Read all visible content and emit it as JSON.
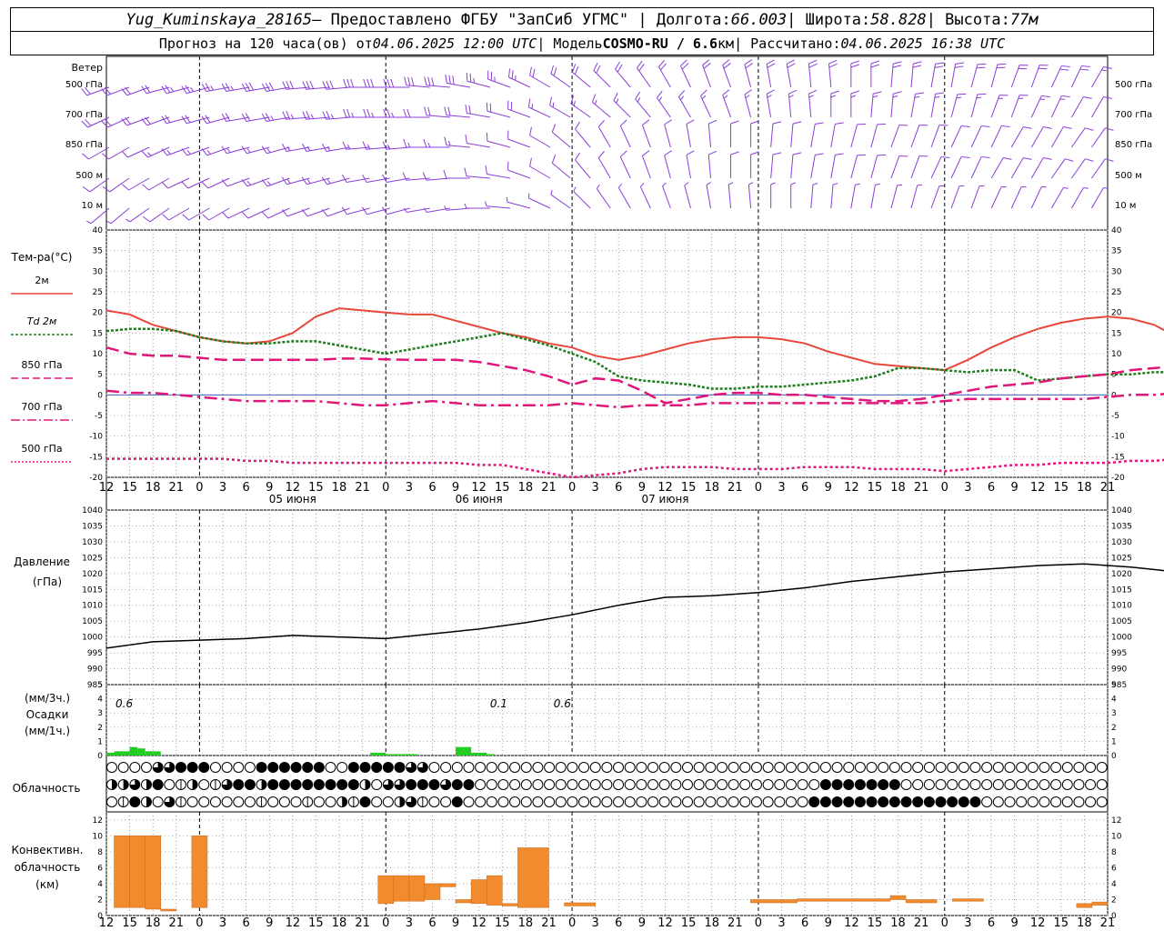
{
  "header": {
    "station": "Yug_Kuminskaya_28165",
    "provider": " — Предоставлено ФГБУ \"ЗапСиб УГМС\" | Долгота: ",
    "lon": "66.003",
    "lat_label": " | Широта: ",
    "lat": "58.828",
    "alt_label": " | Высота: ",
    "alt": "77м",
    "forecast_prefix": "Прогноз на 120 часа(ов) от ",
    "forecast_from": "04.06.2025 12:00 UTC",
    "model_label": " | Модель ",
    "model": "COSMO-RU / 6.6",
    "model_unit": "км",
    "calc_label": " | Рассчитано: ",
    "calc_time": "04.06.2025 16:38 UTC"
  },
  "labels": {
    "wind": "Ветер",
    "wind_levels": [
      "500 гПа",
      "700 гПа",
      "850 гПа",
      "500 м",
      "10   м"
    ],
    "temp": "Тем-ра(°C)",
    "legend": [
      "2м",
      "Td  2м",
      "850 гПа",
      "700 гПа",
      "500 гПа"
    ],
    "pressure": [
      "Давление",
      "(гПа)"
    ],
    "precip": [
      "(мм/3ч.)",
      "Осадки",
      "(мм/1ч.)"
    ],
    "precip_totals": [
      "0.6",
      "0.1",
      "0.6"
    ],
    "cloud": "Облачность",
    "conv": [
      "Конвективн.",
      "облачность",
      "(км)"
    ],
    "days": [
      "05 июня",
      "06 июня",
      "07 июня"
    ],
    "hours": [
      "12",
      "15",
      "18",
      "21",
      "0",
      "3",
      "6",
      "9",
      "12",
      "15",
      "18",
      "21",
      "0",
      "3",
      "6",
      "9",
      "12",
      "15",
      "18",
      "21",
      "0",
      "3",
      "6",
      "9",
      "12",
      "15",
      "18"
    ]
  },
  "colors": {
    "t2m": "#e8483c",
    "td2m": "#1e7d1e",
    "t850": "#e0177a",
    "t700": "#e0177a",
    "t500": "#e0177a",
    "wind": "#8a3fd6",
    "precip": "#22cc22",
    "conv": "#f28a2e"
  },
  "chart_data": [
    {
      "type": "line",
      "title": "Тем-ра(°C)",
      "ylim": [
        -20,
        40
      ],
      "x_hours_from_start": [
        0,
        3,
        6,
        9,
        12,
        15,
        18,
        21,
        24,
        27,
        30,
        33,
        36,
        39,
        42,
        45,
        48,
        51,
        54,
        57,
        60,
        63,
        66,
        69,
        72,
        75,
        78,
        81,
        84,
        87,
        90,
        93,
        96,
        99,
        102,
        105,
        108,
        111,
        114,
        117,
        120,
        123,
        126,
        129,
        132,
        135,
        138,
        141,
        144,
        147,
        150
      ],
      "series": [
        {
          "name": "2м",
          "values": [
            20.5,
            19.5,
            17,
            15.5,
            14,
            13,
            12.5,
            13,
            15,
            19,
            21,
            20.5,
            20,
            19.5,
            19.5,
            18,
            16.5,
            15,
            14,
            12.5,
            11.5,
            9.5,
            8.5,
            9.5,
            11,
            12.5,
            13.5,
            14,
            14,
            13.5,
            12.5,
            10.5,
            9,
            7.5,
            7,
            6.5,
            6,
            8.5,
            11.5,
            14,
            16,
            17.5,
            18.5,
            19,
            18.5,
            17,
            14,
            10.5,
            9,
            8.5,
            8
          ]
        },
        {
          "name": "Td 2м",
          "values": [
            15.5,
            16,
            16,
            15.5,
            14,
            13,
            12.5,
            12.5,
            13,
            13,
            12,
            11,
            10,
            11,
            12,
            13,
            14,
            15,
            13.5,
            12,
            10,
            8,
            4.5,
            3.5,
            3,
            2.5,
            1.5,
            1.5,
            2,
            2,
            2.5,
            3,
            3.5,
            4.5,
            6.5,
            6.5,
            6,
            5.5,
            6,
            6,
            3.5,
            4,
            4.5,
            5,
            5,
            5.5,
            5.5,
            8,
            7.5,
            7,
            7
          ]
        },
        {
          "name": "850 гПа",
          "values": [
            11.5,
            10,
            9.5,
            9.5,
            9,
            8.5,
            8.5,
            8.5,
            8.5,
            8.5,
            8.8,
            8.8,
            8.6,
            8.5,
            8.5,
            8.5,
            8,
            7,
            6,
            4.5,
            2.5,
            4,
            3.5,
            1,
            -2,
            -1,
            0,
            0.5,
            0.5,
            0,
            0,
            -0.5,
            -1,
            -1.5,
            -1.5,
            -1,
            0,
            1,
            2,
            2.5,
            3,
            4,
            4.5,
            5,
            6,
            6.5,
            7,
            7.5,
            8,
            8,
            8
          ]
        },
        {
          "name": "700 гПа",
          "values": [
            1,
            0.5,
            0.5,
            0,
            -0.5,
            -1,
            -1.5,
            -1.5,
            -1.5,
            -1.5,
            -2,
            -2.5,
            -2.5,
            -2,
            -1.5,
            -2,
            -2.5,
            -2.5,
            -2.5,
            -2.5,
            -2,
            -2.5,
            -3,
            -2.5,
            -2.5,
            -2.5,
            -2,
            -2,
            -2,
            -2,
            -2,
            -2,
            -2,
            -2,
            -2,
            -2,
            -1.5,
            -1,
            -1,
            -1,
            -1,
            -1,
            -1,
            -0.5,
            0,
            0,
            0.5,
            0.5,
            1,
            1.5,
            1.5
          ]
        },
        {
          "name": "500 гПа",
          "values": [
            -15.5,
            -15.5,
            -15.5,
            -15.5,
            -15.5,
            -15.5,
            -16,
            -16,
            -16.5,
            -16.5,
            -16.5,
            -16.5,
            -16.5,
            -16.5,
            -16.5,
            -16.5,
            -17,
            -17,
            -18,
            -19,
            -20,
            -19.5,
            -19,
            -18,
            -17.5,
            -17.5,
            -17.5,
            -18,
            -18,
            -18,
            -17.5,
            -17.5,
            -17.5,
            -18,
            -18,
            -18,
            -18.5,
            -18,
            -17.5,
            -17,
            -17,
            -16.5,
            -16.5,
            -16.5,
            -16,
            -16,
            -15.5,
            -15.5,
            -15,
            -15,
            -15
          ]
        }
      ]
    },
    {
      "type": "line",
      "title": "Давление (гПа)",
      "ylim": [
        985,
        1040
      ],
      "x_hours_from_start": [
        0,
        6,
        12,
        18,
        24,
        30,
        36,
        42,
        48,
        54,
        60,
        66,
        72,
        78,
        84,
        90,
        96,
        102,
        108,
        114,
        120,
        126,
        132,
        138,
        144,
        150
      ],
      "series": [
        {
          "name": "Давление",
          "values": [
            996.5,
            998.5,
            999,
            999.5,
            1000.5,
            1000,
            999.5,
            1001,
            1002.5,
            1004.5,
            1007,
            1010,
            1012.5,
            1013,
            1014,
            1015.5,
            1017.5,
            1019,
            1020.5,
            1021.5,
            1022.5,
            1023,
            1022,
            1020.5,
            1020.5,
            1021.5
          ]
        }
      ]
    },
    {
      "type": "bar",
      "title": "Осадки (мм/1ч.)",
      "ylim": [
        0,
        5
      ],
      "x_hours_from_start": [
        0,
        1,
        2,
        3,
        4,
        5,
        6,
        34,
        35,
        36,
        37,
        38,
        39,
        45,
        46,
        47,
        48,
        49
      ],
      "values": [
        0.2,
        0.3,
        0.3,
        0.6,
        0.5,
        0.3,
        0.3,
        0.2,
        0.2,
        0.1,
        0.1,
        0.1,
        0.1,
        0.6,
        0.6,
        0.2,
        0.2,
        0.1
      ]
    },
    {
      "type": "bar",
      "title": "Конвективн. облачность (км)",
      "ylim": [
        0,
        12
      ],
      "bars": [
        {
          "start_h": 1,
          "end_h": 3,
          "base": 1,
          "top": 10
        },
        {
          "start_h": 3,
          "end_h": 5,
          "base": 1,
          "top": 10
        },
        {
          "start_h": 5,
          "end_h": 7,
          "base": 0.8,
          "top": 10
        },
        {
          "start_h": 7,
          "end_h": 9,
          "base": 0.7,
          "top": 0.8
        },
        {
          "start_h": 11,
          "end_h": 13,
          "base": 1,
          "top": 10
        },
        {
          "start_h": 35,
          "end_h": 37,
          "base": 1.5,
          "top": 5
        },
        {
          "start_h": 37,
          "end_h": 39,
          "base": 1.8,
          "top": 5
        },
        {
          "start_h": 39,
          "end_h": 41,
          "base": 1.8,
          "top": 5
        },
        {
          "start_h": 41,
          "end_h": 43,
          "base": 2,
          "top": 4
        },
        {
          "start_h": 43,
          "end_h": 45,
          "base": 3.6,
          "top": 4
        },
        {
          "start_h": 45,
          "end_h": 47,
          "base": 1.6,
          "top": 2
        },
        {
          "start_h": 47,
          "end_h": 49,
          "base": 1.5,
          "top": 4.5
        },
        {
          "start_h": 49,
          "end_h": 51,
          "base": 1.3,
          "top": 5
        },
        {
          "start_h": 51,
          "end_h": 53,
          "base": 1.2,
          "top": 1.5
        },
        {
          "start_h": 53,
          "end_h": 57,
          "base": 1,
          "top": 8.5
        },
        {
          "start_h": 59,
          "end_h": 63,
          "base": 1.2,
          "top": 1.6
        },
        {
          "start_h": 83,
          "end_h": 89,
          "base": 1.6,
          "top": 2
        },
        {
          "start_h": 89,
          "end_h": 101,
          "base": 1.8,
          "top": 2.1
        },
        {
          "start_h": 101,
          "end_h": 103,
          "base": 2,
          "top": 2.5
        },
        {
          "start_h": 103,
          "end_h": 107,
          "base": 1.6,
          "top": 2
        },
        {
          "start_h": 109,
          "end_h": 113,
          "base": 1.8,
          "top": 2.1
        },
        {
          "start_h": 125,
          "end_h": 127,
          "base": 1,
          "top": 1.5
        },
        {
          "start_h": 127,
          "end_h": 129,
          "base": 1.3,
          "top": 1.7
        }
      ]
    }
  ],
  "cloud_rows": [
    "00003344400004444440044444330000000000000000000000000000000000000000000000000000000000000004",
    "22324012013442444444442033444344000000000000000000000000000000444444400000000000000000000004",
    "01420310000001000100214002310040000000000000000000000000000004444444444444440000000000000000"
  ],
  "wind_rows": [
    {
      "level": "500 гПа",
      "dir_deg": [
        250,
        250,
        250,
        255,
        255,
        255,
        260,
        260,
        260,
        260,
        265,
        265,
        265,
        270,
        270,
        270,
        275,
        275,
        280,
        285,
        290,
        295,
        300,
        305,
        310,
        315,
        320,
        325,
        330,
        335,
        340,
        340,
        345,
        350,
        350,
        355,
        355,
        0,
        0,
        5,
        5,
        10,
        10,
        15,
        15,
        20,
        20,
        25,
        25,
        30
      ],
      "speed": [
        20,
        20,
        22,
        22,
        24,
        25,
        25,
        26,
        28,
        28,
        30,
        30,
        32,
        32,
        32,
        30,
        30,
        28,
        28,
        26,
        25,
        25,
        22,
        22,
        20,
        20,
        20,
        18,
        18,
        18,
        18,
        18,
        18,
        18,
        20,
        20,
        20,
        20,
        20,
        22,
        22,
        22,
        22,
        22,
        22,
        20,
        20,
        18,
        18,
        16
      ]
    },
    {
      "level": "700 гПа",
      "dir_deg": [
        245,
        245,
        250,
        250,
        255,
        255,
        255,
        260,
        260,
        260,
        265,
        265,
        265,
        270,
        270,
        270,
        270,
        275,
        275,
        280,
        285,
        290,
        295,
        300,
        305,
        310,
        315,
        320,
        325,
        330,
        335,
        340,
        345,
        350,
        355,
        355,
        0,
        0,
        5,
        5,
        10,
        10,
        15,
        15,
        20,
        20,
        25,
        25,
        30,
        30
      ],
      "speed": [
        18,
        18,
        18,
        20,
        20,
        20,
        22,
        22,
        22,
        24,
        24,
        24,
        25,
        25,
        24,
        24,
        22,
        22,
        20,
        20,
        18,
        18,
        16,
        16,
        15,
        15,
        15,
        14,
        14,
        14,
        14,
        14,
        14,
        15,
        15,
        15,
        15,
        15,
        16,
        16,
        16,
        16,
        15,
        15,
        15,
        14,
        14,
        13,
        12,
        12
      ]
    },
    {
      "level": "850 гПа",
      "dir_deg": [
        240,
        240,
        245,
        245,
        250,
        250,
        250,
        255,
        255,
        255,
        260,
        260,
        260,
        265,
        265,
        265,
        270,
        270,
        275,
        280,
        285,
        290,
        300,
        310,
        320,
        330,
        335,
        340,
        345,
        350,
        355,
        0,
        0,
        5,
        5,
        10,
        10,
        15,
        15,
        20,
        20,
        20,
        25,
        25,
        25,
        30,
        30,
        30,
        35,
        35
      ],
      "speed": [
        12,
        12,
        12,
        14,
        14,
        14,
        15,
        15,
        15,
        16,
        16,
        16,
        16,
        16,
        16,
        15,
        15,
        14,
        14,
        12,
        12,
        10,
        10,
        10,
        10,
        10,
        10,
        10,
        12,
        12,
        12,
        12,
        12,
        12,
        12,
        12,
        12,
        12,
        12,
        12,
        12,
        12,
        12,
        10,
        10,
        10,
        10,
        10,
        10,
        10
      ]
    },
    {
      "level": "500 м",
      "dir_deg": [
        235,
        235,
        240,
        240,
        245,
        245,
        245,
        250,
        250,
        250,
        255,
        255,
        255,
        260,
        260,
        260,
        265,
        265,
        270,
        275,
        280,
        290,
        300,
        310,
        320,
        330,
        335,
        340,
        345,
        350,
        355,
        0,
        0,
        5,
        5,
        10,
        10,
        15,
        15,
        20,
        20,
        25,
        25,
        25,
        30,
        30,
        30,
        35,
        35,
        35
      ],
      "speed": [
        10,
        10,
        10,
        12,
        12,
        12,
        12,
        12,
        14,
        14,
        14,
        14,
        14,
        12,
        12,
        12,
        12,
        10,
        10,
        10,
        8,
        8,
        8,
        8,
        8,
        8,
        8,
        8,
        10,
        10,
        10,
        10,
        10,
        10,
        10,
        10,
        10,
        10,
        10,
        10,
        10,
        8,
        8,
        8,
        8,
        8,
        8,
        8,
        8,
        8
      ]
    },
    {
      "level": "10 м",
      "dir_deg": [
        230,
        230,
        235,
        235,
        240,
        240,
        240,
        245,
        245,
        245,
        250,
        250,
        250,
        255,
        255,
        255,
        260,
        260,
        265,
        270,
        275,
        285,
        295,
        305,
        315,
        325,
        330,
        335,
        340,
        345,
        350,
        355,
        355,
        0,
        0,
        5,
        5,
        10,
        10,
        15,
        15,
        20,
        20,
        20,
        25,
        25,
        25,
        30,
        30,
        30
      ],
      "speed": [
        6,
        6,
        6,
        8,
        8,
        8,
        8,
        8,
        8,
        8,
        8,
        8,
        8,
        8,
        8,
        8,
        6,
        6,
        6,
        6,
        6,
        5,
        5,
        5,
        5,
        5,
        5,
        5,
        6,
        6,
        6,
        6,
        6,
        6,
        6,
        6,
        6,
        6,
        6,
        6,
        6,
        5,
        5,
        5,
        5,
        5,
        5,
        5,
        5,
        5
      ]
    }
  ]
}
